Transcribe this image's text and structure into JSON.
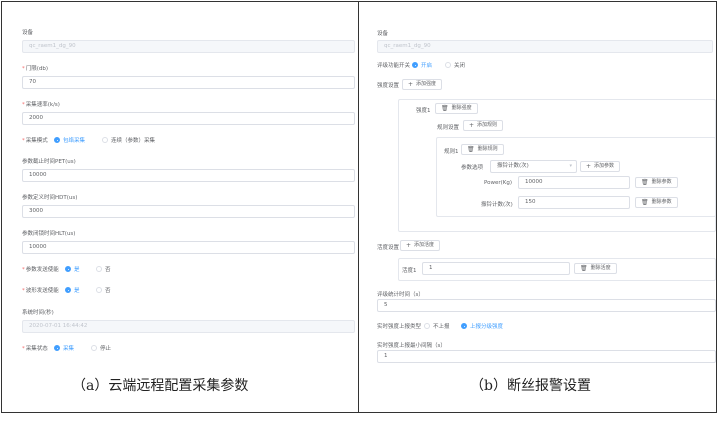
{
  "left": {
    "device_label": "设备",
    "device_value": "qc_raem1_dg_90",
    "threshold_label": "门限(db)",
    "threshold_value": "70",
    "sample_rate_label": "采集速率(k/s)",
    "sample_rate_value": "2000",
    "mode_label": "采集模式",
    "mode_opt1": "包络采集",
    "mode_opt2": "连续（参数）采集",
    "pet_label": "参数截止时间PET(us)",
    "pet_value": "10000",
    "hdt_label": "参数定义时间HDT(us)",
    "hdt_value": "3000",
    "hlt_label": "参数闭锁时间HLT(us)",
    "hlt_value": "10000",
    "param_enable_label": "参数发送使能",
    "wave_enable_label": "波形发送使能",
    "yes": "是",
    "no": "否",
    "time_label": "系统时间(秒)",
    "time_value": "2020-07-01 16:44:42",
    "status_label": "采集状态",
    "status_opt1": "采集",
    "status_opt2": "停止"
  },
  "right": {
    "device_label": "设备",
    "device_value": "qc_raem1_dg_90",
    "switch_label": "评级功能开关",
    "switch_on": "开启",
    "switch_off": "关闭",
    "level_label": "强度设置",
    "add_level": "添加强度",
    "level1_label": "强度1",
    "del_level": "删除强度",
    "rule_label": "规则设置",
    "add_rule": "添加规则",
    "rule1_label": "规则1",
    "del_rule": "删除规则",
    "param_label": "参数选项",
    "param_select": "振铃计数(次)",
    "add_param": "添加参数",
    "power_label": "Power(Kg)",
    "power_value": "10000",
    "del_param": "删除参数",
    "ring_label": "振铃计数(次)",
    "ring_value": "150",
    "activity_label": "活度设置",
    "add_activity": "添加活度",
    "activity1_label": "活度1",
    "activity1_value": "1",
    "del_activity": "删除活度",
    "period_label": "评级统计时间（s）",
    "period_value": "5",
    "report_type_label": "实时强度上报类型",
    "report_opt1": "不上报",
    "report_opt2": "上报分级强度",
    "report_min_label": "实时强度上报最小间隔（s）",
    "report_min_value": "1"
  },
  "captions": {
    "a": "（a）云端远程配置采集参数",
    "b": "（b）断丝报警设置"
  },
  "colors": {
    "accent": "#409eff",
    "required": "#f56c6c",
    "border": "#dcdfe6"
  },
  "icons": {
    "add": "plus-icon",
    "delete": "trash-icon",
    "dropdown": "chevron-down-icon"
  }
}
